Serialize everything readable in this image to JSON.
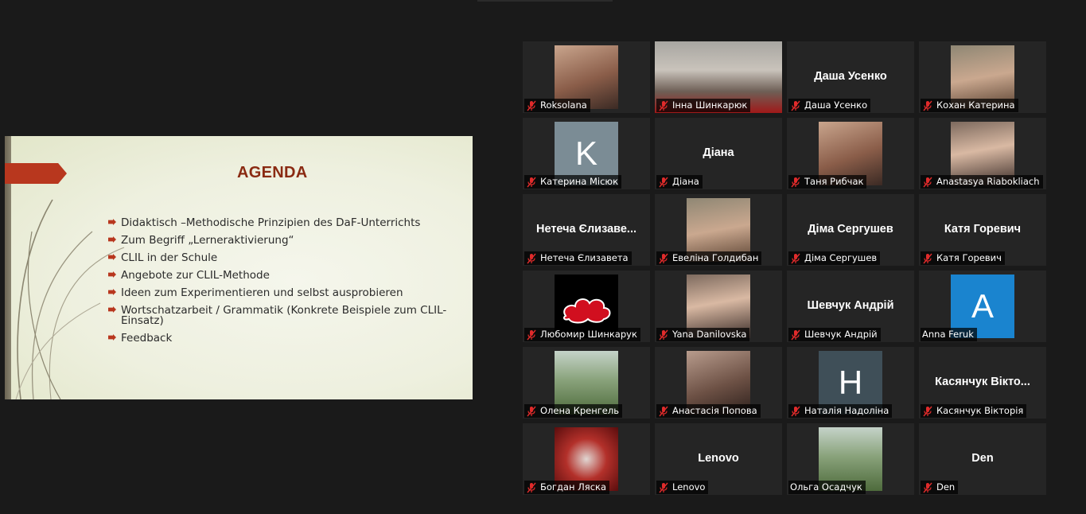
{
  "slide": {
    "title": "AGENDA",
    "items": [
      "Didaktisch –Methodische Prinzipien des DaF-Unterrichts",
      "Zum Begriff „Lerneraktivierung“",
      "CLIL in der Schule",
      "Angebote zur CLIL-Methode",
      "Ideen zum Experimentieren und selbst ausprobieren",
      "Wortschatzarbeit / Grammatik (Konkrete Beispiele zum CLIL-Einsatz)",
      "Feedback"
    ],
    "accent_color": "#b8371e",
    "title_color": "#8a2a12"
  },
  "participants": [
    {
      "name": "Roksolana",
      "display": "",
      "video": "photo",
      "muted": true
    },
    {
      "name": "Інна Шинкарюк",
      "display": "",
      "video": "wide",
      "muted": true
    },
    {
      "name": "Даша Усенко",
      "display": "Даша Усенко",
      "video": "none",
      "muted": true
    },
    {
      "name": "Кохан Катерина",
      "display": "",
      "video": "photo",
      "muted": true
    },
    {
      "name": "Катерина Місюк",
      "display": "",
      "video": "avatar",
      "avatar_letter": "K",
      "avatar_color": "#7b8c95",
      "muted": true
    },
    {
      "name": "Діана",
      "display": "Діана",
      "video": "none",
      "muted": true
    },
    {
      "name": "Таня Рибчак",
      "display": "",
      "video": "photo",
      "muted": true
    },
    {
      "name": "Anastasya Riabokliach",
      "display": "",
      "video": "photo",
      "muted": true
    },
    {
      "name": "Нетеча Єлизавета",
      "display": "Нетеча Єлизаве...",
      "video": "none",
      "muted": true
    },
    {
      "name": "Евеліна Голдибан",
      "display": "",
      "video": "photo",
      "muted": true
    },
    {
      "name": "Діма Сергушев",
      "display": "Діма Сергушев",
      "video": "none",
      "muted": true
    },
    {
      "name": "Катя Горевич",
      "display": "Катя Горевич",
      "video": "none",
      "muted": true
    },
    {
      "name": "Любомир Шинкарук",
      "display": "",
      "video": "photo",
      "muted": true
    },
    {
      "name": "Yana Danilovska",
      "display": "",
      "video": "photo",
      "muted": true
    },
    {
      "name": "Шевчук Андрій",
      "display": "Шевчук Андрій",
      "video": "none",
      "muted": true
    },
    {
      "name": "Anna Feruk",
      "display": "",
      "video": "avatar",
      "avatar_letter": "A",
      "avatar_color": "#1a84cf",
      "muted": false
    },
    {
      "name": "Олена Кренгель",
      "display": "",
      "video": "photo",
      "muted": true
    },
    {
      "name": "Анастасія Попова",
      "display": "",
      "video": "photo",
      "muted": true
    },
    {
      "name": "Наталія Надоліна",
      "display": "",
      "video": "avatar",
      "avatar_letter": "H",
      "avatar_color": "#3f4f58",
      "muted": true
    },
    {
      "name": "Касянчук Вікторія",
      "display": "Касянчук Вікто...",
      "video": "none",
      "muted": true
    },
    {
      "name": "Богдан Ляска",
      "display": "",
      "video": "photo",
      "muted": true
    },
    {
      "name": "Lenovo",
      "display": "Lenovo",
      "video": "none",
      "muted": true
    },
    {
      "name": "Ольга Осадчук",
      "display": "",
      "video": "photo",
      "muted": false
    },
    {
      "name": "Den",
      "display": "Den",
      "video": "none",
      "muted": true
    }
  ]
}
